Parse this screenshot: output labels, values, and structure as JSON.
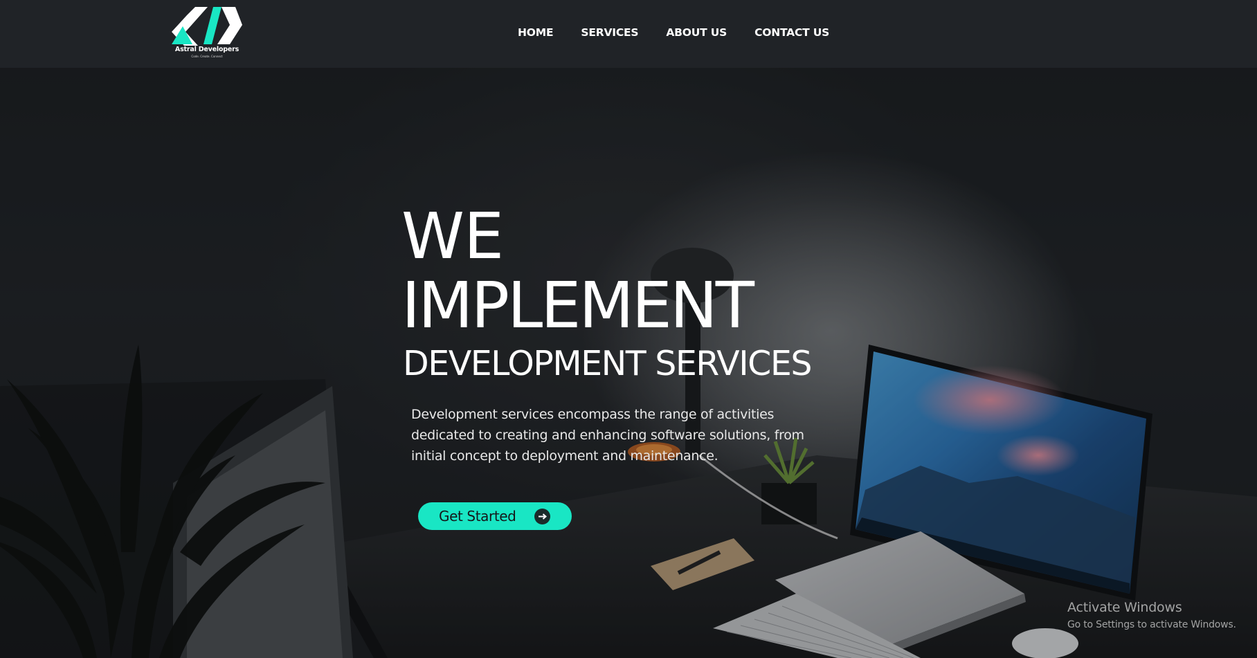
{
  "brand": {
    "name": "Astral Developers",
    "tagline": "Code. Create. Connect",
    "accent_color": "#19e6c4"
  },
  "nav": {
    "items": [
      {
        "label": "HOME"
      },
      {
        "label": "SERVICES"
      },
      {
        "label": "ABOUT US"
      },
      {
        "label": "CONTACT US"
      }
    ]
  },
  "hero": {
    "headline_line1": "WE",
    "headline_line2": "IMPLEMENT",
    "headline_line3": "DEVELOPMENT SERVICES",
    "description": "Development services encompass the range of activities dedicated to creating and enhancing software solutions, from initial concept to deployment and maintenance.",
    "cta_label": "Get Started",
    "cta_icon": "arrow-right-circle-icon"
  },
  "os_watermark": {
    "title": "Activate Windows",
    "subtitle": "Go to Settings to activate Windows."
  }
}
